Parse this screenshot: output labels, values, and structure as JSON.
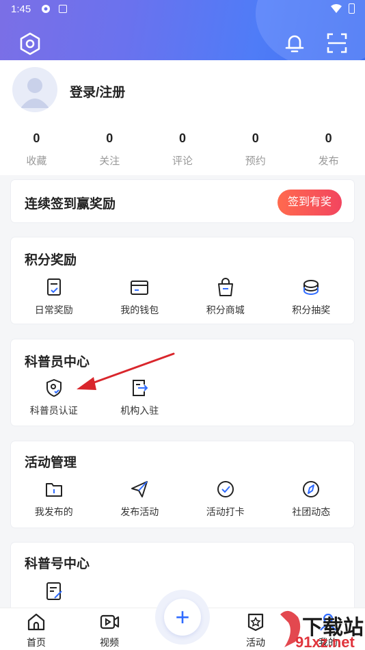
{
  "status": {
    "time": "1:45"
  },
  "profile": {
    "login_label": "登录/注册"
  },
  "stats": [
    {
      "num": "0",
      "label": "收藏"
    },
    {
      "num": "0",
      "label": "关注"
    },
    {
      "num": "0",
      "label": "评论"
    },
    {
      "num": "0",
      "label": "预约"
    },
    {
      "num": "0",
      "label": "发布"
    }
  ],
  "signin": {
    "title": "连续签到赢奖励",
    "button": "签到有奖"
  },
  "points": {
    "title": "积分奖励",
    "items": [
      "日常奖励",
      "我的钱包",
      "积分商城",
      "积分抽奖"
    ]
  },
  "science": {
    "title": "科普员中心",
    "items": [
      "科普员认证",
      "机构入驻"
    ]
  },
  "activity": {
    "title": "活动管理",
    "items": [
      "我发布的",
      "发布活动",
      "活动打卡",
      "社团动态"
    ]
  },
  "account": {
    "title": "科普号中心"
  },
  "tabs": {
    "home": "首页",
    "video": "视频",
    "activity": "活动",
    "mine": "我的",
    "plus": "+"
  },
  "watermark": {
    "text": "下载站",
    "url": "91xz.net"
  },
  "colors": {
    "accent": "#2f6bff",
    "signin_gradient_start": "#ff6a4e",
    "signin_gradient_end": "#f2455f",
    "arrow": "#d9262c"
  }
}
